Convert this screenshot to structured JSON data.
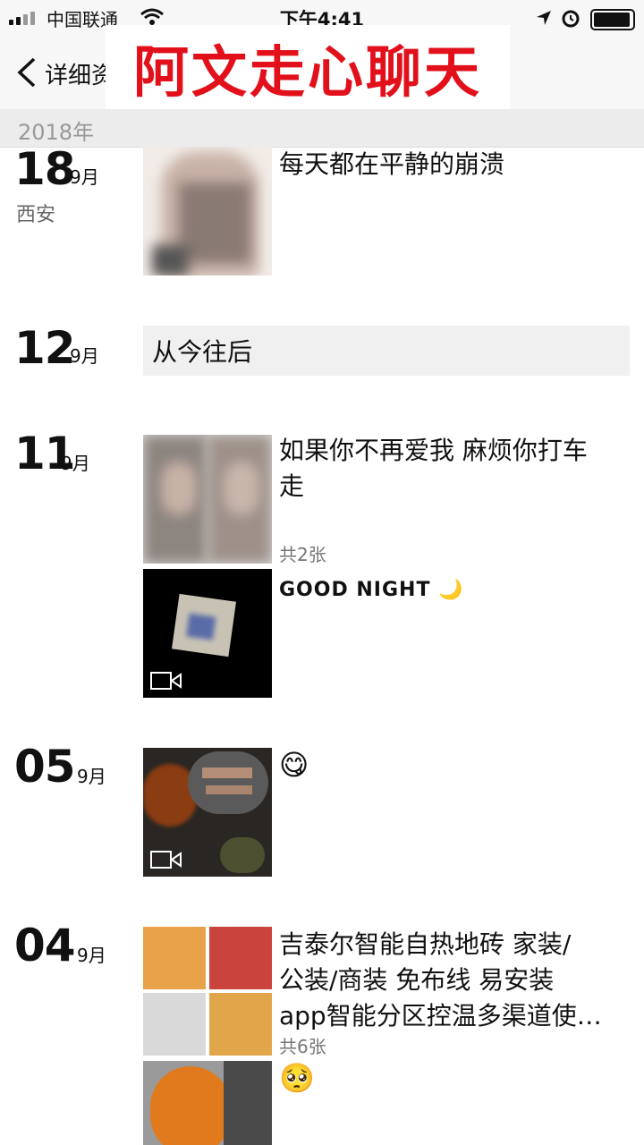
{
  "status_bar": {
    "carrier": "中国联通",
    "time": "下午4:41"
  },
  "nav": {
    "back_label": "详细资"
  },
  "overlay_title": "阿文走心聊天",
  "year_header": "2018年",
  "entries": [
    {
      "day": "18",
      "month": "9月",
      "location": "西安",
      "text": "每天都在平静的崩溃"
    },
    {
      "day": "12",
      "month": "9月",
      "text": "从今往后"
    },
    {
      "day": "11",
      "month": "9月",
      "text_line1": "如果你不再爱我 麻烦你打车",
      "text_line2": "走",
      "count": "共2张"
    },
    {
      "text": "GOOD NIGHT 🌙"
    },
    {
      "day": "05",
      "month": "9月",
      "emoji": "😋"
    },
    {
      "day": "04",
      "month": "9月",
      "text_line1": "吉泰尔智能自热地砖 家装/",
      "text_line2": "公装/商装 免布线 易安装",
      "text_line3": "app智能分区控温多渠道使…",
      "count": "共6张"
    },
    {
      "emoji": "🥺"
    }
  ],
  "colors": {
    "overlay_red": "#e1101b",
    "bar_bg": "#f7f7f7",
    "text_gray": "#777777"
  }
}
